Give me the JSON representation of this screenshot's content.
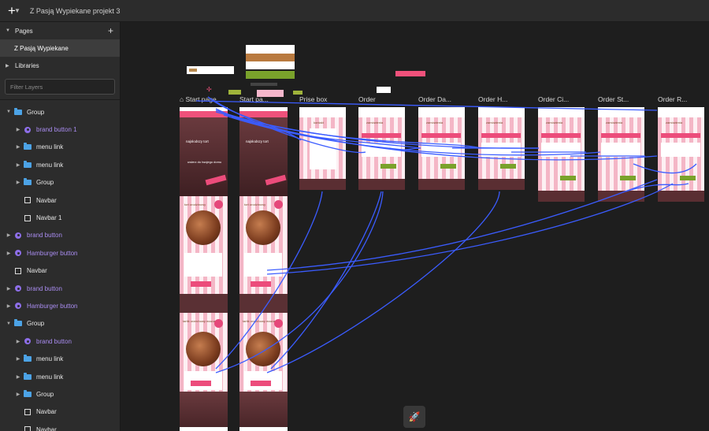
{
  "topbar": {
    "add_icon": "plus-icon",
    "title": "Z Pasją Wypiekane projekt 3"
  },
  "sidebar": {
    "pages_label": "Pages",
    "current_page": "Z Pasją Wypiekane",
    "libraries_label": "Libraries",
    "filter_placeholder": "Filter Layers",
    "layers": [
      {
        "label": "Group",
        "type": "folder",
        "expanded": true,
        "indent": 0
      },
      {
        "label": "brand button 1",
        "type": "component",
        "indent": 1
      },
      {
        "label": "menu link",
        "type": "folder",
        "indent": 1
      },
      {
        "label": "menu link",
        "type": "folder",
        "indent": 1
      },
      {
        "label": "Group",
        "type": "folder",
        "indent": 1
      },
      {
        "label": "Navbar",
        "type": "rect",
        "indent": 1
      },
      {
        "label": "Navbar 1",
        "type": "rect",
        "indent": 1
      },
      {
        "label": "brand button",
        "type": "component",
        "indent": 0
      },
      {
        "label": "Hamburger button",
        "type": "component",
        "indent": 0
      },
      {
        "label": "Navbar",
        "type": "rect",
        "indent": 0
      },
      {
        "label": "brand button",
        "type": "component",
        "indent": 0
      },
      {
        "label": "Hamburger button",
        "type": "component",
        "indent": 0
      },
      {
        "label": "Group",
        "type": "folder",
        "expanded": true,
        "indent": 0
      },
      {
        "label": "brand button",
        "type": "component",
        "indent": 1
      },
      {
        "label": "menu link",
        "type": "folder",
        "indent": 1
      },
      {
        "label": "menu link",
        "type": "folder",
        "indent": 1
      },
      {
        "label": "Group",
        "type": "folder",
        "indent": 1
      },
      {
        "label": "Navbar",
        "type": "rect",
        "indent": 1
      },
      {
        "label": "Navbar",
        "type": "rect",
        "indent": 1
      }
    ]
  },
  "canvas": {
    "boards": [
      {
        "label": "Start page",
        "home": true
      },
      {
        "label": "Start pa..."
      },
      {
        "label": "Prise box"
      },
      {
        "label": "Order"
      },
      {
        "label": "Order Da..."
      },
      {
        "label": "Order H..."
      },
      {
        "label": "Order Ci..."
      },
      {
        "label": "Order St..."
      },
      {
        "label": "Order R..."
      }
    ],
    "frame_texts": {
      "headline": "najsłodszy tort",
      "subline": "uwierz do twojego domu",
      "section1": "tort urodzinowy",
      "section2": "tartik orzechowy mazurek",
      "prise": "kontakt",
      "order": "zamówienia"
    },
    "colors": {
      "accent_pink": "#f0517b",
      "accent_green": "#7aa22b",
      "link_blue": "#3b5cff"
    },
    "rocket_icon": "rocket-icon"
  }
}
